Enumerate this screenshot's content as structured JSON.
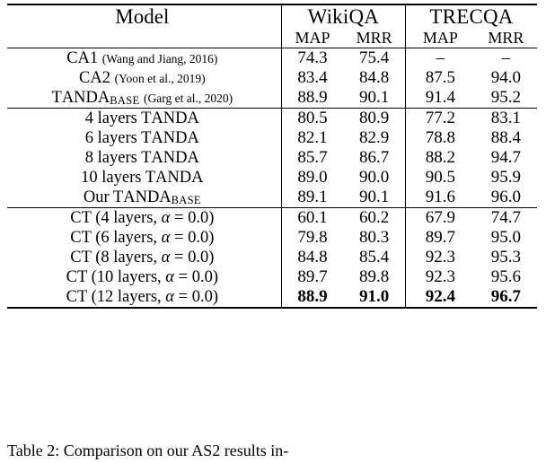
{
  "table": {
    "header": {
      "model_label": "Model",
      "groups": [
        {
          "label": "WikiQA",
          "metrics": [
            "MAP",
            "MRR"
          ]
        },
        {
          "label": "TRECQA",
          "metrics": [
            "MAP",
            "MRR"
          ]
        }
      ]
    },
    "sections": [
      {
        "rows": [
          {
            "model": "CA1",
            "model_style": "smallcaps-first",
            "citation": "(Wang and Jiang, 2016)",
            "values": [
              "74.3",
              "75.4",
              "–",
              "–"
            ],
            "bold": [
              false,
              false,
              false,
              false
            ]
          },
          {
            "model": "CA2",
            "citation": "(Yoon et al., 2019)",
            "values": [
              "83.4",
              "84.8",
              "87.5",
              "94.0"
            ],
            "bold": [
              false,
              false,
              false,
              false
            ]
          },
          {
            "model": "TANDA",
            "subscript": "BASE",
            "citation": "(Garg et al., 2020)",
            "values": [
              "88.9",
              "90.1",
              "91.4",
              "95.2"
            ],
            "bold": [
              false,
              false,
              false,
              false
            ]
          }
        ]
      },
      {
        "rows": [
          {
            "model": "4 layers TANDA",
            "values": [
              "80.5",
              "80.9",
              "77.2",
              "83.1"
            ],
            "bold": [
              false,
              false,
              false,
              false
            ]
          },
          {
            "model": "6 layers TANDA",
            "values": [
              "82.1",
              "82.9",
              "78.8",
              "88.4"
            ],
            "bold": [
              false,
              false,
              false,
              false
            ]
          },
          {
            "model": "8 layers TANDA",
            "values": [
              "85.7",
              "86.7",
              "88.2",
              "94.7"
            ],
            "bold": [
              false,
              false,
              false,
              false
            ]
          },
          {
            "model": "10 layers TANDA",
            "values": [
              "89.0",
              "90.0",
              "90.5",
              "95.9"
            ],
            "bold": [
              false,
              false,
              false,
              false
            ]
          },
          {
            "model": "Our TANDA",
            "subscript": "BASE",
            "values": [
              "89.1",
              "90.1",
              "91.6",
              "96.0"
            ],
            "bold": [
              false,
              false,
              false,
              false
            ]
          }
        ]
      },
      {
        "rows": [
          {
            "model": "CT (4 layers, α = 0.0)",
            "values": [
              "60.1",
              "60.2",
              "67.9",
              "74.7"
            ],
            "bold": [
              false,
              false,
              false,
              false
            ]
          },
          {
            "model": "CT (6 layers, α = 0.0)",
            "values": [
              "79.8",
              "80.3",
              "89.7",
              "95.0"
            ],
            "bold": [
              false,
              false,
              false,
              false
            ]
          },
          {
            "model": "CT (8 layers, α = 0.0)",
            "values": [
              "84.8",
              "85.4",
              "92.3",
              "95.3"
            ],
            "bold": [
              false,
              false,
              false,
              false
            ]
          },
          {
            "model": "CT (10 layers, α = 0.0)",
            "values": [
              "89.7",
              "89.8",
              "92.3",
              "95.6"
            ],
            "bold": [
              false,
              false,
              false,
              false
            ]
          },
          {
            "model": "CT (12 layers, α = 0.0)",
            "values": [
              "88.9",
              "91.0",
              "92.4",
              "96.7"
            ],
            "bold": [
              true,
              true,
              true,
              true
            ]
          }
        ]
      }
    ]
  },
  "caption": "Table 2: Comparison on our AS2 results in-",
  "rows_text": {
    "r1_model": "CA1",
    "r1_cite": "(Wang and Jiang, 2016)",
    "r2_model": "CA2",
    "r2_cite": "(Yoon et al., 2019)",
    "r3_model": "T",
    "r3_model_sc": "ANDA",
    "r3_sub": "BASE",
    "r3_cite": "(Garg et al., 2020)",
    "s2_r1_pre": "4 layers T",
    "s2_r1_sc": "ANDA",
    "s2_r2_pre": "6 layers T",
    "s2_r2_sc": "ANDA",
    "s2_r3_pre": "8 layers T",
    "s2_r3_sc": "ANDA",
    "s2_r4_pre": "10 layers T",
    "s2_r4_sc": "ANDA",
    "s2_r5_pre": "Our T",
    "s2_r5_sc": "ANDA",
    "s2_r5_sub": "BASE",
    "s3_r1_pre": "CT (4 layers, ",
    "s3_r2_pre": "CT (6 layers, ",
    "s3_r3_pre": "CT (8 layers, ",
    "s3_r4_pre": "CT (10 layers, ",
    "s3_r5_pre": "CT (12 layers, ",
    "alpha_eq": " = 0.0)",
    "alpha_sym": "α"
  }
}
